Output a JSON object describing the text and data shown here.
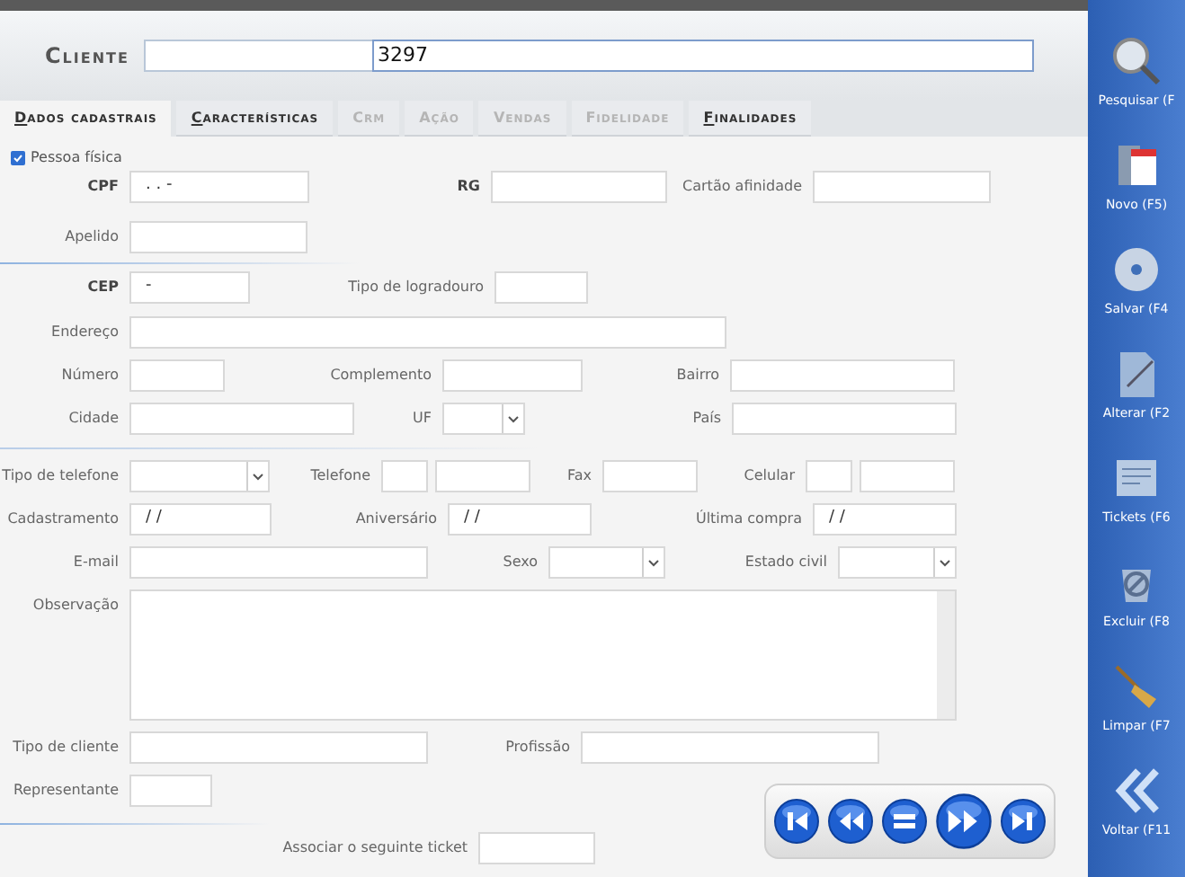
{
  "header": {
    "label": "Cliente",
    "value": "3297"
  },
  "tabs": [
    {
      "label": "Dados cadastrais",
      "selected": true,
      "disabled": false,
      "underlined": true
    },
    {
      "label": "Características",
      "selected": false,
      "disabled": false,
      "underlined": true
    },
    {
      "label": "Crm",
      "selected": false,
      "disabled": true,
      "underlined": false
    },
    {
      "label": "Ação",
      "selected": false,
      "disabled": true,
      "underlined": false
    },
    {
      "label": "Vendas",
      "selected": false,
      "disabled": true,
      "underlined": false
    },
    {
      "label": "Fidelidade",
      "selected": false,
      "disabled": true,
      "underlined": false
    },
    {
      "label": "Finalidades",
      "selected": false,
      "disabled": false,
      "underlined": true
    }
  ],
  "person_checkbox": {
    "label": "Pessoa física",
    "checked": true
  },
  "form_rows": [
    {
      "fields": [
        {
          "label": "CPF",
          "kind": "text",
          "value": ". . -",
          "bold": true
        },
        {
          "label": "RG",
          "kind": "text",
          "bold": true
        },
        {
          "label": "Cartão afinidade",
          "kind": "text",
          "bold": false
        }
      ]
    },
    {
      "fields": [
        {
          "label": "Apelido",
          "kind": "text",
          "bold": false
        }
      ]
    },
    {
      "fields": [
        {
          "label": "CEP",
          "kind": "text",
          "value": "-",
          "bold": true
        },
        {
          "label": "Tipo de logradouro",
          "kind": "text",
          "bold": false
        }
      ]
    },
    {
      "fields": [
        {
          "label": "Endereço",
          "kind": "text",
          "bold": false
        }
      ]
    },
    {
      "fields": [
        {
          "label": "Número",
          "kind": "text",
          "bold": false
        },
        {
          "label": "Complemento",
          "kind": "text",
          "bold": false
        },
        {
          "label": "Bairro",
          "kind": "text",
          "bold": false
        }
      ]
    },
    {
      "fields": [
        {
          "label": "Cidade",
          "kind": "text",
          "bold": false
        },
        {
          "label": "UF",
          "kind": "select",
          "bold": false
        },
        {
          "label": "País",
          "kind": "text",
          "bold": false
        }
      ]
    },
    {
      "fields": [
        {
          "label": "Tipo de telefone",
          "kind": "select",
          "bold": false
        },
        {
          "label": "Telefone",
          "kind": "split",
          "bold": false
        },
        {
          "label": "Fax",
          "kind": "text",
          "bold": false
        },
        {
          "label": "Celular",
          "kind": "split",
          "bold": false
        }
      ]
    },
    {
      "fields": [
        {
          "label": "Cadastramento",
          "kind": "text",
          "value": "/ /",
          "bold": false
        },
        {
          "label": "Aniversário",
          "kind": "text",
          "value": "/ /",
          "bold": false
        },
        {
          "label": "Última compra",
          "kind": "text",
          "value": "/ /",
          "bold": false
        }
      ]
    },
    {
      "fields": [
        {
          "label": "E-mail",
          "kind": "text",
          "bold": false
        },
        {
          "label": "Sexo",
          "kind": "select",
          "bold": false
        },
        {
          "label": "Estado civil",
          "kind": "select",
          "bold": false
        }
      ]
    },
    {
      "fields": [
        {
          "label": "Observação",
          "kind": "textarea",
          "bold": false
        }
      ]
    },
    {
      "fields": [
        {
          "label": "Tipo de cliente",
          "kind": "text",
          "bold": false
        },
        {
          "label": "Profissão",
          "kind": "text",
          "bold": false
        }
      ]
    },
    {
      "fields": [
        {
          "label": "Representante",
          "kind": "text",
          "bold": false
        }
      ]
    },
    {
      "fields": [
        {
          "label": "Associar o seguinte ticket",
          "kind": "text",
          "bold": false
        }
      ]
    }
  ],
  "nav_buttons": [
    {
      "kind": "first"
    },
    {
      "kind": "previous"
    },
    {
      "kind": "equal"
    },
    {
      "kind": "next"
    },
    {
      "kind": "last"
    }
  ],
  "sidebar": {
    "items": [
      {
        "label": "Pesquisar (F",
        "kind": "search"
      },
      {
        "label": "Novo (F5)",
        "kind": "new"
      },
      {
        "label": "Salvar (F4",
        "kind": "save"
      },
      {
        "label": "Alterar (F2",
        "kind": "edit"
      },
      {
        "label": "Tickets (F6",
        "kind": "tickets"
      },
      {
        "label": "Excluir (F8",
        "kind": "delete"
      },
      {
        "label": "Limpar (F7",
        "kind": "clear"
      },
      {
        "label": "Voltar (F11",
        "kind": "back"
      }
    ]
  }
}
